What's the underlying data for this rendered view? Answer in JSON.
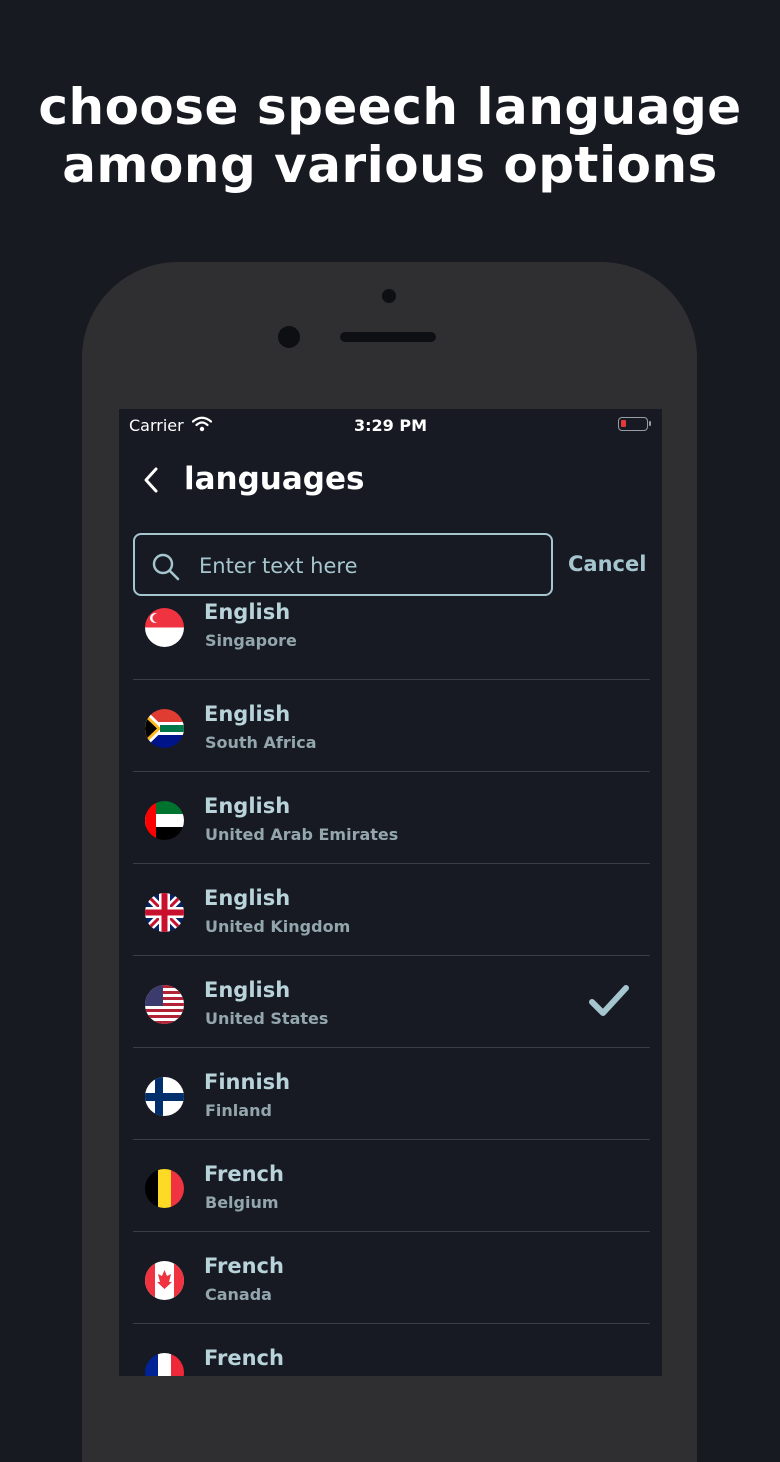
{
  "headline": {
    "line1": "choose speech language",
    "line2": "among various options"
  },
  "status_bar": {
    "carrier": "Carrier",
    "time": "3:29 PM"
  },
  "nav": {
    "title": "languages"
  },
  "search": {
    "placeholder": "Enter text here",
    "cancel_label": "Cancel"
  },
  "languages": [
    {
      "language": "English",
      "region": "Singapore"
    },
    {
      "language": "English",
      "region": "South Africa"
    },
    {
      "language": "English",
      "region": "United Arab Emirates"
    },
    {
      "language": "English",
      "region": "United Kingdom"
    },
    {
      "language": "English",
      "region": "United States",
      "selected": true
    },
    {
      "language": "Finnish",
      "region": "Finland"
    },
    {
      "language": "French",
      "region": "Belgium"
    },
    {
      "language": "French",
      "region": "Canada"
    },
    {
      "language": "French",
      "region": ""
    }
  ],
  "colors": {
    "background": "#171a21",
    "accent": "#a6c6cf",
    "phone_frame": "#2f2f31"
  }
}
